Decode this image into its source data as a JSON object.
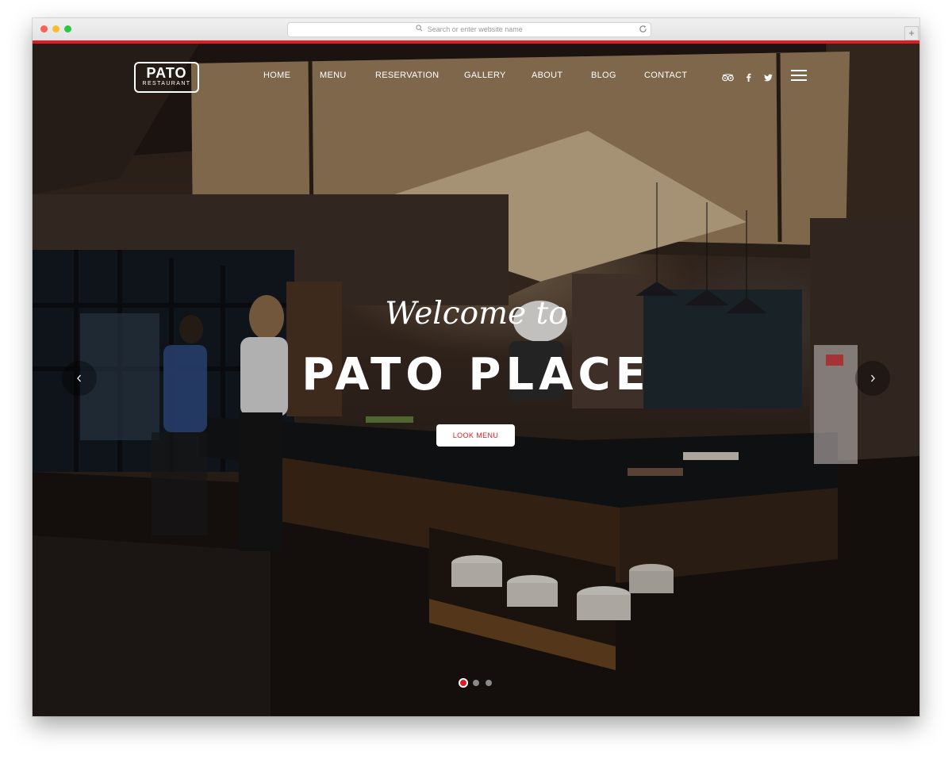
{
  "browser": {
    "address_placeholder": "Search or enter website name",
    "new_tab_symbol": "+"
  },
  "site": {
    "logo_name": "PATO",
    "logo_subtitle": "RESTAURANT",
    "nav": [
      "HOME",
      "MENU",
      "RESERVATION",
      "GALLERY",
      "ABOUT",
      "BLOG",
      "CONTACT"
    ],
    "social_icons": [
      "tripadvisor-icon",
      "facebook-icon",
      "twitter-icon"
    ],
    "accent_color": "#e21b22"
  },
  "hero": {
    "welcome": "Welcome to",
    "title": "PATO PLACE",
    "cta": "LOOK MENU",
    "slides_total": 3,
    "active_slide": 1
  }
}
